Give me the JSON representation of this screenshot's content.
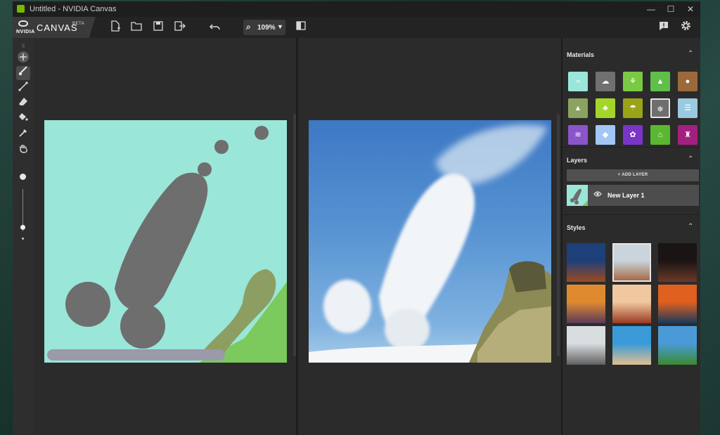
{
  "window": {
    "title": "Untitled - NVIDIA Canvas",
    "controls": [
      "—",
      "☐",
      "✕"
    ]
  },
  "brand": {
    "logo": "NVIDIA",
    "name": "CANVAS",
    "badge": "BETA"
  },
  "toolbar": {
    "icons": [
      "new-file-icon",
      "open-folder-icon",
      "save-icon",
      "export-icon",
      "undo-icon",
      "compare-view-icon",
      "feedback-icon",
      "settings-icon"
    ],
    "zoom": "109%"
  },
  "tools": [
    "pan-tool",
    "brush-tool",
    "line-tool",
    "eraser-tool",
    "fill-tool",
    "eyedropper-tool",
    "hand-tool"
  ],
  "brush_size_level": 0.1,
  "panel": {
    "materials_label": "Materials",
    "layers_label": "Layers",
    "styles_label": "Styles",
    "add_layer_label": "+ ADD LAYER",
    "layer_name": "New Layer 1"
  },
  "materials": [
    {
      "name": "water",
      "color": "#9ae6d8"
    },
    {
      "name": "cloud",
      "color": "#707070"
    },
    {
      "name": "grass",
      "color": "#7ac943"
    },
    {
      "name": "mountain",
      "color": "#5fbf4a"
    },
    {
      "name": "dirt",
      "color": "#9c6a3a"
    },
    {
      "name": "hill",
      "color": "#8ba360"
    },
    {
      "name": "tree",
      "color": "#a4d62a"
    },
    {
      "name": "bush",
      "color": "#9aa418"
    },
    {
      "name": "snow",
      "color": "#6e6e6e"
    },
    {
      "name": "fog",
      "color": "#9ac9e0"
    },
    {
      "name": "river",
      "color": "#8a55c8"
    },
    {
      "name": "ice",
      "color": "#a3c7f5"
    },
    {
      "name": "flowers",
      "color": "#7a35c8"
    },
    {
      "name": "house",
      "color": "#5ab830"
    },
    {
      "name": "structure",
      "color": "#a32080"
    }
  ],
  "styles": [
    {
      "name": "style-1",
      "sky": "#1d3f7a",
      "ground": "#9a4a20"
    },
    {
      "name": "style-2",
      "sky": "#c9d4db",
      "ground": "#a56a48"
    },
    {
      "name": "style-3",
      "sky": "#1a1414",
      "ground": "#6a3a2a"
    },
    {
      "name": "style-4",
      "sky": "#e08a30",
      "ground": "#5a3a5a"
    },
    {
      "name": "style-5",
      "sky": "#f0c8a0",
      "ground": "#9a3a20"
    },
    {
      "name": "style-6",
      "sky": "#e06020",
      "ground": "#1a3a5a"
    },
    {
      "name": "style-7",
      "sky": "#d8dde0",
      "ground": "#606060"
    },
    {
      "name": "style-8",
      "sky": "#3a9ad8",
      "ground": "#e0c090"
    },
    {
      "name": "style-9",
      "sky": "#4a9ad8",
      "ground": "#3a8a30"
    }
  ]
}
